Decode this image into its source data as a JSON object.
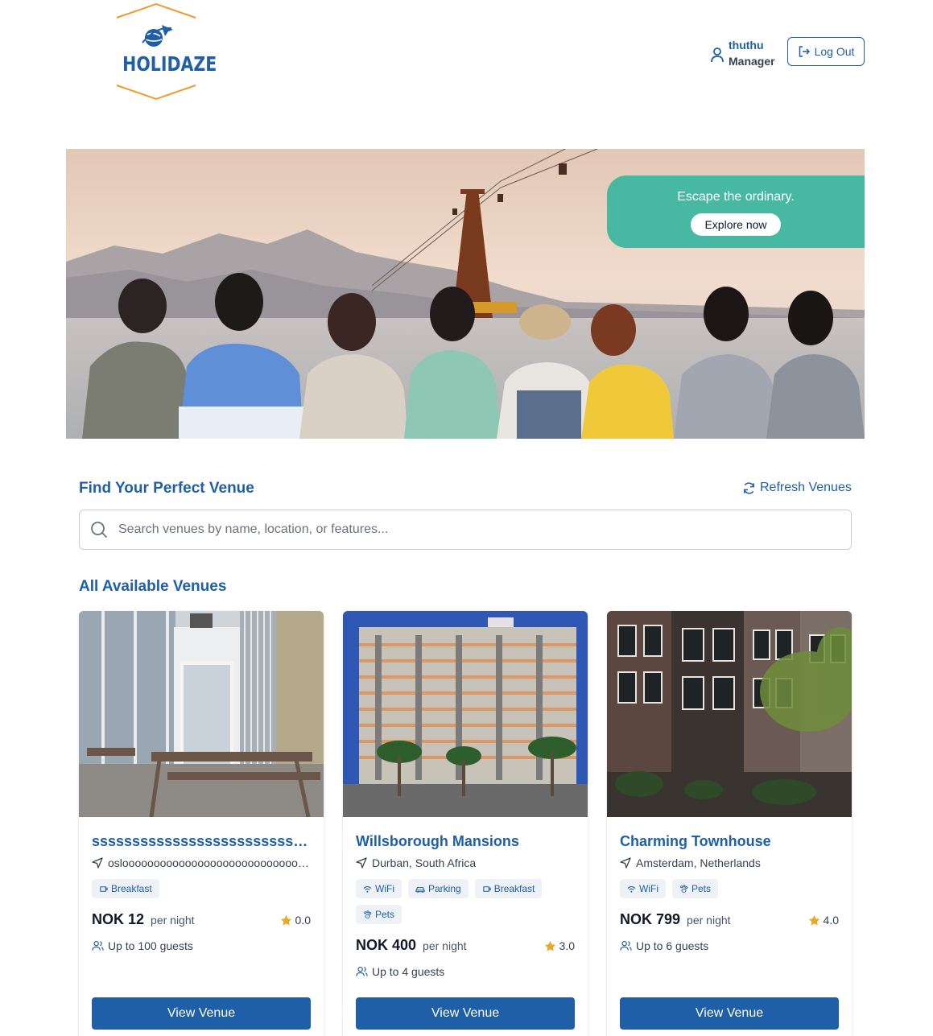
{
  "header": {
    "logo_text": "HOLIDAZE",
    "user_name": "thuthu",
    "user_role": "Manager",
    "logout_label": "Log Out"
  },
  "hero": {
    "tagline": "Escape the ordinary.",
    "cta_label": "Explore now"
  },
  "search": {
    "title": "Find Your Perfect Venue",
    "refresh_label": "Refresh Venues",
    "placeholder": "Search venues by name, location, or features..."
  },
  "venues": {
    "section_title": "All Available Venues",
    "per_night_label": "per night",
    "view_label": "View Venue",
    "items": [
      {
        "name": "sssssssssssssssssssssssssssssssssssss",
        "location": "osloooooooooooooooooooooooooooooooooooo",
        "tags": [
          "Breakfast"
        ],
        "price": "NOK 12",
        "rating": "0.0",
        "guests": "Up to 100 guests"
      },
      {
        "name": "Willsborough Mansions",
        "location": "Durban, South Africa",
        "tags": [
          "WiFi",
          "Parking",
          "Breakfast",
          "Pets"
        ],
        "price": "NOK 400",
        "rating": "3.0",
        "guests": "Up to 4 guests"
      },
      {
        "name": "Charming Townhouse",
        "location": "Amsterdam, Netherlands",
        "tags": [
          "WiFi",
          "Pets"
        ],
        "price": "NOK 799",
        "rating": "4.0",
        "guests": "Up to 6 guests"
      }
    ]
  },
  "colors": {
    "primary": "#1e5fa8",
    "promo": "#47b9a3",
    "star": "#e9a826",
    "logo_frame": "#f29a2e"
  }
}
